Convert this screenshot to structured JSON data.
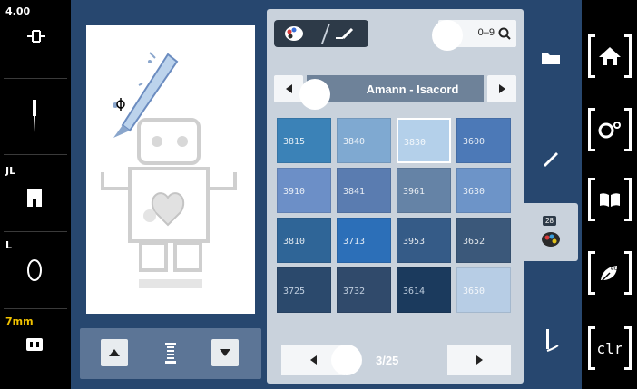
{
  "left_column": {
    "stitch_width": "4.00",
    "foot_label": "JL",
    "size_label": "L",
    "hoop_label": "7mm"
  },
  "picker": {
    "search_label": "0–9",
    "brand": "Amann - Isacord",
    "page": "3/25",
    "swatches": [
      {
        "code": "3815",
        "color": "#3b82b7"
      },
      {
        "code": "3840",
        "color": "#7fa9d1"
      },
      {
        "code": "3830",
        "color": "#b4d0ea"
      },
      {
        "code": "3600",
        "color": "#4c79b7"
      },
      {
        "code": "3910",
        "color": "#6c8fc7"
      },
      {
        "code": "3841",
        "color": "#5a7cb0"
      },
      {
        "code": "3961",
        "color": "#6583a6"
      },
      {
        "code": "3630",
        "color": "#6d94c8"
      },
      {
        "code": "3810",
        "color": "#2f6597"
      },
      {
        "code": "3713",
        "color": "#2c6fb8"
      },
      {
        "code": "3953",
        "color": "#355b87"
      },
      {
        "code": "3652",
        "color": "#3b587a"
      },
      {
        "code": "3725",
        "color": "#2b496c"
      },
      {
        "code": "3732",
        "color": "#304a6b"
      },
      {
        "code": "3614",
        "color": "#1b3a5d"
      },
      {
        "code": "3650",
        "color": "#b7cde5"
      }
    ]
  },
  "side_tabs": {
    "badge": "28"
  },
  "right_column": {
    "clear_label": "clr",
    "eco_label": "eco"
  }
}
